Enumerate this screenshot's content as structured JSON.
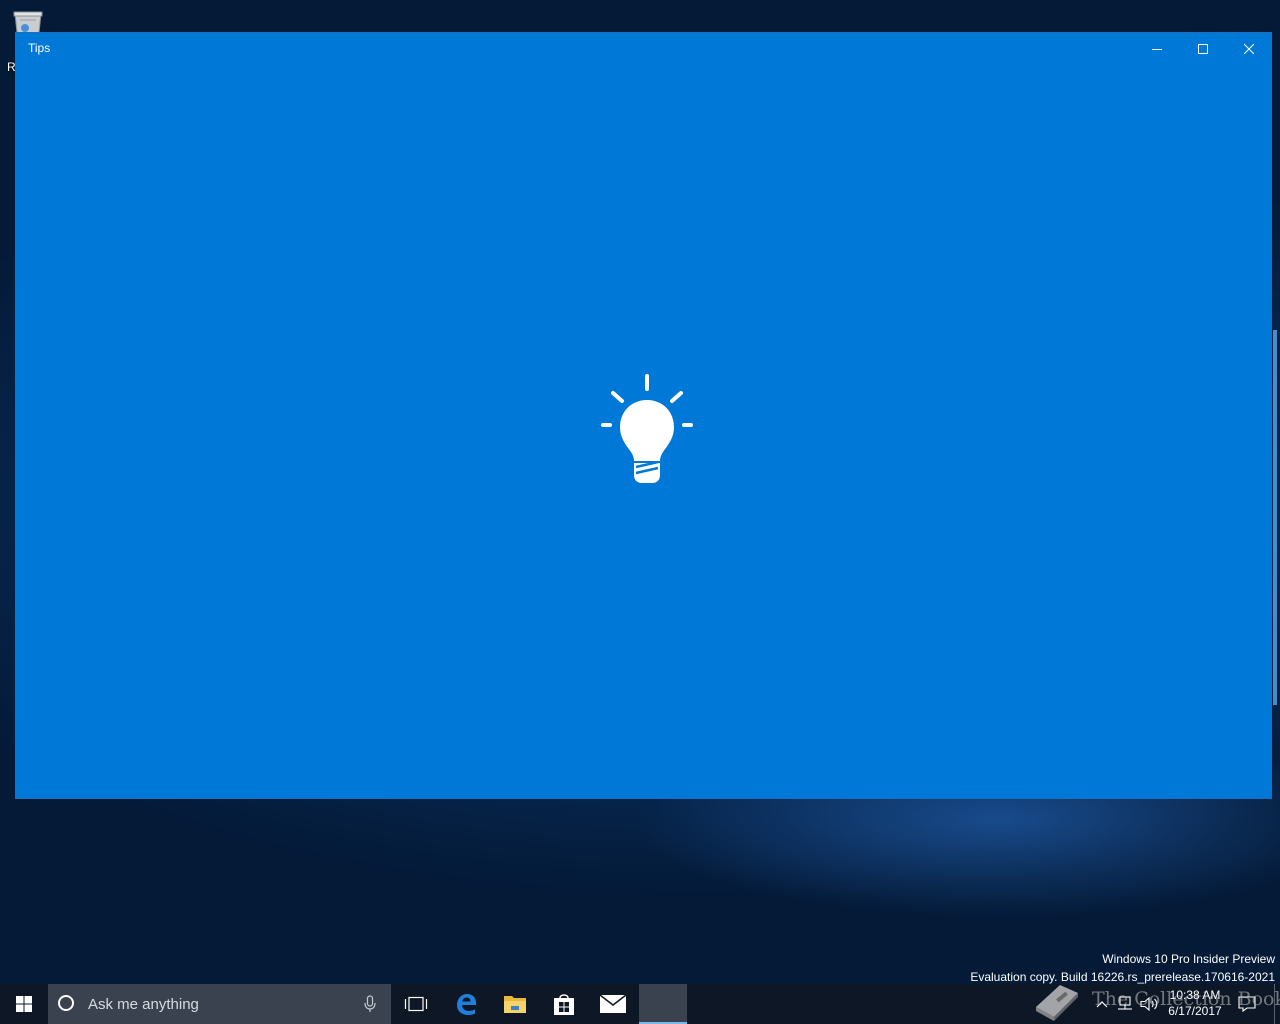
{
  "desktop": {
    "recycle_bin_label": "R"
  },
  "window": {
    "title": "Tips",
    "background": "#0078d7",
    "icon": "lightbulb-icon"
  },
  "watermark": {
    "line1": "Windows 10 Pro Insider Preview",
    "line2": "Evaluation copy. Build 16226.rs_prerelease.170616-2021"
  },
  "taskbar": {
    "search_placeholder": "Ask me anything",
    "pinned": [
      "task-view",
      "edge",
      "file-explorer",
      "store",
      "mail",
      "tips"
    ],
    "clock": {
      "time": "10:38 AM",
      "date": "6/17/2017"
    }
  },
  "overlay": {
    "text": "The Collection Book"
  }
}
